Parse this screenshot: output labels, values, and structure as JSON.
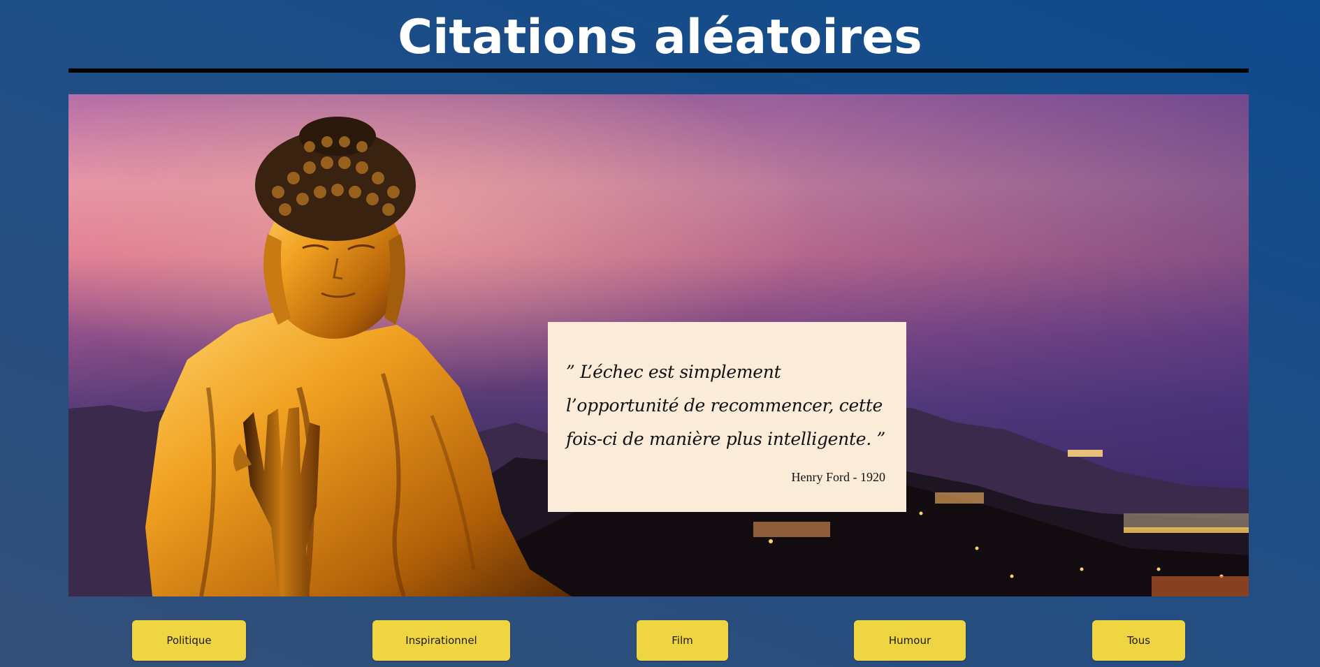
{
  "header": {
    "title": "Citations aléatoires"
  },
  "quote": {
    "text": "” L’échec est simplement l’opportunité de recommencer, cette fois-ci de manière plus intelligente. ”",
    "author": "Henry Ford - 1920"
  },
  "categories": [
    {
      "label": "Politique"
    },
    {
      "label": "Inspirationnel"
    },
    {
      "label": "Film"
    },
    {
      "label": "Humour"
    },
    {
      "label": "Tous"
    }
  ],
  "colors": {
    "background": "#1a4d87",
    "button": "#f0d542",
    "card": "#fbebd9",
    "title": "#ffffff"
  }
}
